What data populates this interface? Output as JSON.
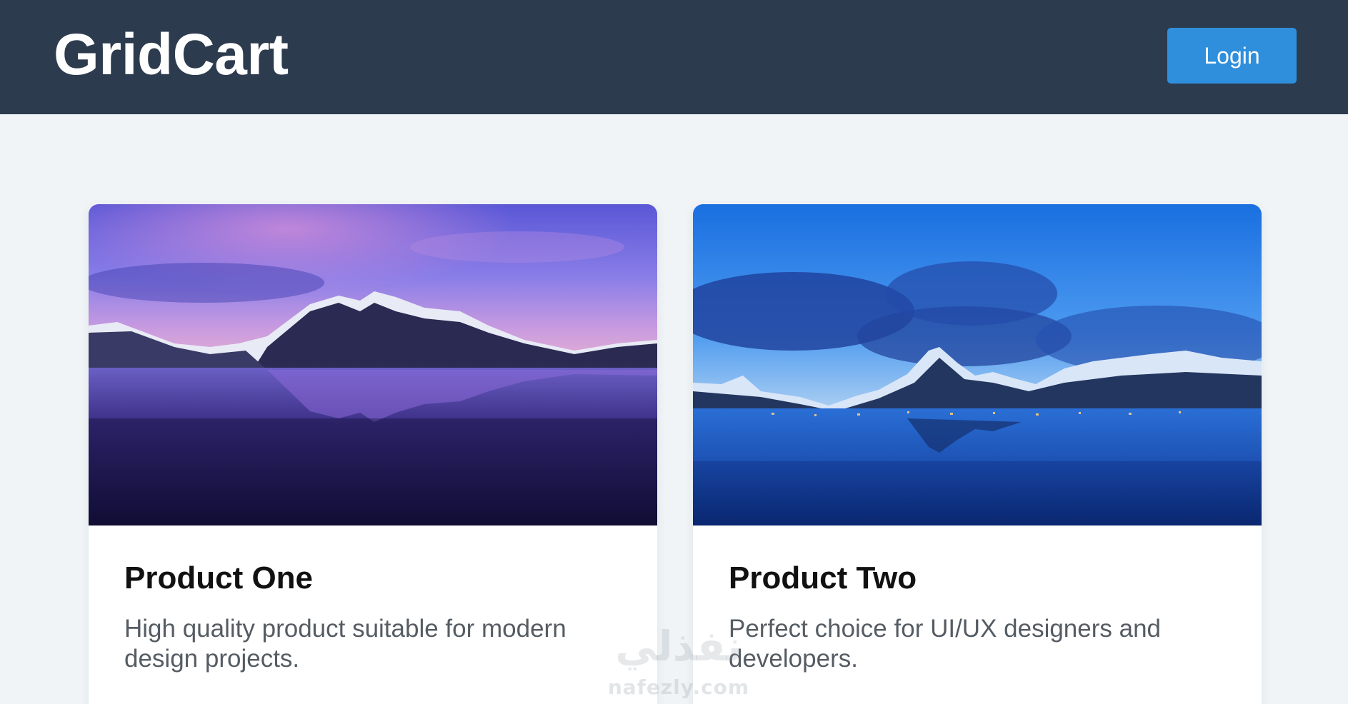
{
  "header": {
    "logo": "GridCart",
    "login_label": "Login"
  },
  "products": [
    {
      "title": "Product One",
      "description": "High quality product suitable for modern design projects.",
      "image": "mountain-lake-purple-dusk"
    },
    {
      "title": "Product Two",
      "description": "Perfect choice for UI/UX designers and developers.",
      "image": "mountain-village-blue-hour"
    }
  ],
  "watermark": {
    "arabic": "نفذلي",
    "latin": "nafezly.com"
  },
  "colors": {
    "header_bg": "#2d3b4e",
    "page_bg": "#f0f4f7",
    "accent": "#2f8fdc"
  }
}
